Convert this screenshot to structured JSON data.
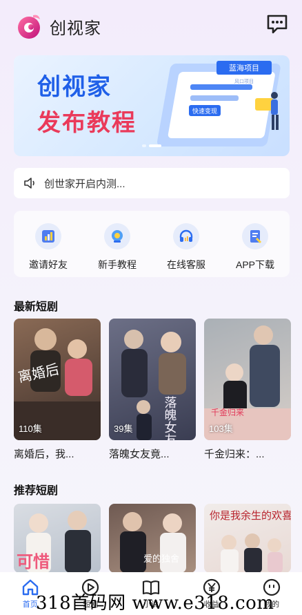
{
  "header": {
    "app_name": "创视家",
    "logo_icon": "swirl-logo-icon",
    "message_icon": "chat-bubble-icon"
  },
  "banner": {
    "line1": "创视家",
    "line2": "发布教程",
    "art_tags": [
      "蓝海项目",
      "快速变现",
      "风口项目"
    ],
    "active_dot": 1,
    "dot_count": 2
  },
  "notice": {
    "icon": "speaker-icon",
    "text": "创世家开启内测..."
  },
  "quick": [
    {
      "label": "邀请好友",
      "icon": "invite-chart-icon"
    },
    {
      "label": "新手教程",
      "icon": "tutorial-icon"
    },
    {
      "label": "在线客服",
      "icon": "headset-icon"
    },
    {
      "label": "APP下载",
      "icon": "download-doc-icon"
    }
  ],
  "latest": {
    "title": "最新短剧",
    "items": [
      {
        "title": "离婚后，我...",
        "episodes": "110集",
        "poster_text": "离婚后",
        "bg1": "#8a6a55",
        "bg2": "#3d2f2a"
      },
      {
        "title": "落魄女友竟...",
        "episodes": "39集",
        "poster_text": "落魄女友",
        "bg1": "#6c6f86",
        "bg2": "#3a3d52"
      },
      {
        "title": "千金归来：...",
        "episodes": "103集",
        "poster_text": "千金归来",
        "bg1": "#9aa0a6",
        "bg2": "#c9c2bd"
      }
    ]
  },
  "recommend": {
    "title": "推荐短剧",
    "items": [
      {
        "poster_text": "可惜",
        "bg1": "#d9dde3",
        "bg2": "#b9c1cc"
      },
      {
        "poster_text": "爱的独舍",
        "bg1": "#6f5a52",
        "bg2": "#a88f80"
      },
      {
        "poster_text": "你是我余生的欢喜",
        "bg1": "#f1ecea",
        "bg2": "#e8d9d4"
      }
    ]
  },
  "tabs": [
    {
      "label": "首页",
      "icon": "home-icon",
      "active": true
    },
    {
      "label": "短剧",
      "icon": "play-circle-icon",
      "active": false
    },
    {
      "label": "小说",
      "icon": "book-icon",
      "active": false
    },
    {
      "label": "收益",
      "icon": "yen-circle-icon",
      "active": false
    },
    {
      "label": "我的",
      "icon": "smiley-icon",
      "active": false
    }
  ],
  "watermark": "318首码网 www.e318.com",
  "colors": {
    "primary": "#2b6cf0",
    "banner_blue": "#1f5fe8",
    "banner_red": "#ea3a5a",
    "logo_pink": "#e8407a"
  }
}
